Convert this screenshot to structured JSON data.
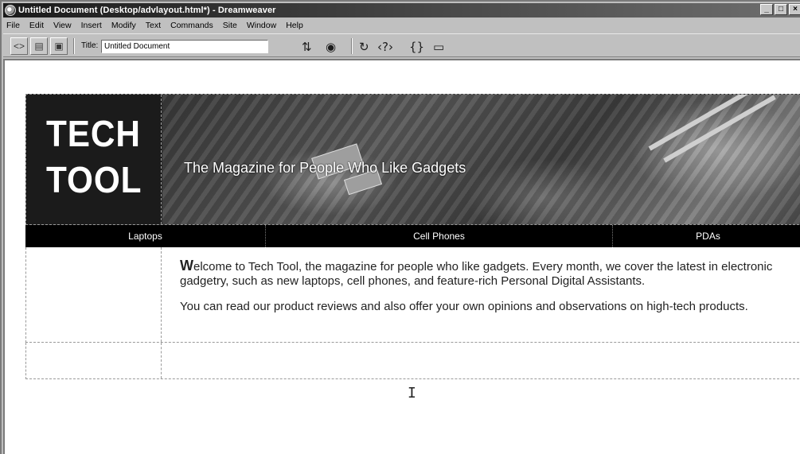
{
  "window": {
    "title": "Untitled Document (Desktop/advlayout.html*) - Dreamweaver",
    "minimize": "_",
    "maximize": "□",
    "close": "×"
  },
  "menu": [
    "File",
    "Edit",
    "View",
    "Insert",
    "Modify",
    "Text",
    "Commands",
    "Site",
    "Window",
    "Help"
  ],
  "toolbar": {
    "title_label": "Title:",
    "title_value": "Untitled Document",
    "icons": [
      "code-view-icon",
      "split-view-icon",
      "design-view-icon",
      "file-management-icon",
      "preview-icon",
      "refresh-icon",
      "code-navigation-icon",
      "view-options-icon",
      "visual-aids-icon"
    ]
  },
  "page": {
    "logo_line1": "TECH",
    "logo_line2": "TOOL",
    "tagline": "The Magazine for People Who Like Gadgets",
    "nav": [
      "Laptops",
      "Cell Phones",
      "PDAs"
    ],
    "content": {
      "dropcap": "W",
      "para1_rest": "elcome to Tech Tool, the magazine for people who like gadgets. Every month, we cover the latest in electronic gadgetry, such as new laptops, cell phones, and feature-rich Personal Digital Assistants.",
      "para2": "You can read our product reviews and also offer your own opinions and observations on high-tech products."
    }
  }
}
